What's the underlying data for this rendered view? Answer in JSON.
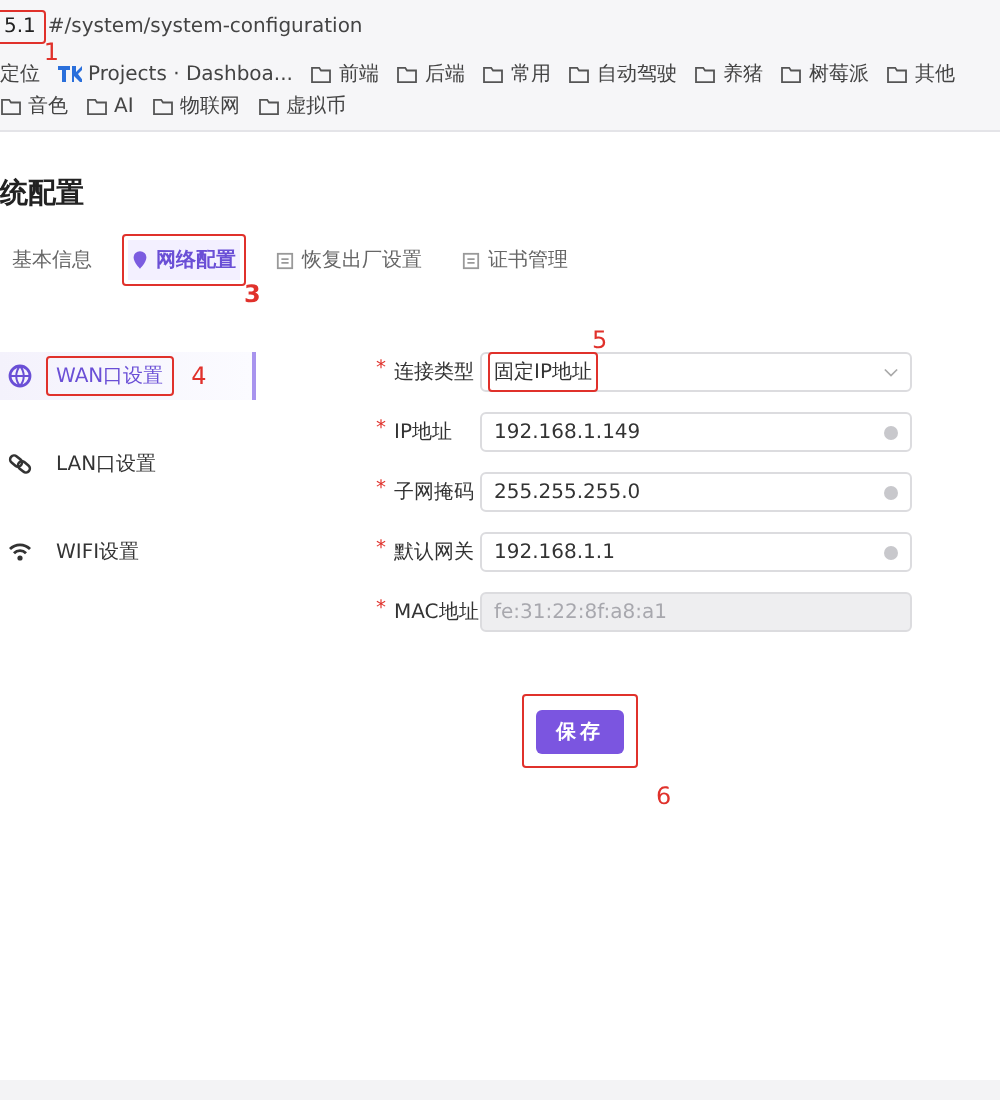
{
  "address_bar": {
    "host": "5.1",
    "path": "#/system/system-configuration",
    "annotation": "1"
  },
  "bookmarks": [
    {
      "kind": "text",
      "label": "定位"
    },
    {
      "kind": "site",
      "label": "Projects · Dashboa..."
    },
    {
      "kind": "folder",
      "label": "前端"
    },
    {
      "kind": "folder",
      "label": "后端"
    },
    {
      "kind": "folder",
      "label": "常用"
    },
    {
      "kind": "folder",
      "label": "自动驾驶"
    },
    {
      "kind": "folder",
      "label": "养猪"
    },
    {
      "kind": "folder",
      "label": "树莓派"
    },
    {
      "kind": "folder",
      "label": "其他"
    },
    {
      "kind": "folder",
      "label": "音色"
    },
    {
      "kind": "folder",
      "label": "AI"
    },
    {
      "kind": "folder",
      "label": "物联网"
    },
    {
      "kind": "folder",
      "label": "虚拟币"
    }
  ],
  "page_title": "统配置",
  "tabs": [
    {
      "label": "基本信息",
      "selected": false
    },
    {
      "label": "网络配置",
      "selected": true,
      "annotation": "3"
    },
    {
      "label": "恢复出厂设置",
      "selected": false
    },
    {
      "label": "证书管理",
      "selected": false
    }
  ],
  "menu": [
    {
      "label": "WAN口设置",
      "selected": true,
      "annotation": "4"
    },
    {
      "label": "LAN口设置",
      "selected": false
    },
    {
      "label": "WIFI设置",
      "selected": false
    }
  ],
  "form": [
    {
      "kind": "select",
      "required_mark": "*",
      "label": "连接类型",
      "value": "固定IP地址",
      "annotation": "5"
    },
    {
      "kind": "input",
      "required_mark": "*",
      "label": "IP地址",
      "value": "192.168.1.149"
    },
    {
      "kind": "input",
      "required_mark": "*",
      "label": "子网掩码",
      "value": "255.255.255.0"
    },
    {
      "kind": "input",
      "required_mark": "*",
      "label": "默认网关",
      "value": "192.168.1.1"
    },
    {
      "kind": "disabled",
      "required_mark": "*",
      "label": "MAC地址",
      "value": "fe:31:22:8f:a8:a1"
    }
  ],
  "save_button": {
    "label": "保存",
    "annotation": "6"
  }
}
